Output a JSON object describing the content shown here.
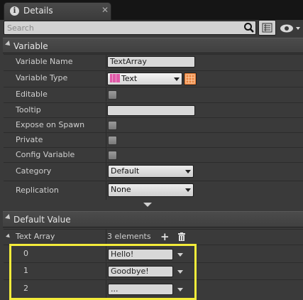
{
  "tab": {
    "title": "Details",
    "close_glyph": "✕",
    "info_glyph": "i"
  },
  "search": {
    "placeholder": "Search",
    "value": ""
  },
  "sections": {
    "variable": {
      "label": "Variable"
    },
    "default_value": {
      "label": "Default Value"
    }
  },
  "properties": {
    "variable_name": {
      "label": "Variable Name",
      "value": "TextArray"
    },
    "variable_type": {
      "label": "Variable Type",
      "value": "Text"
    },
    "editable": {
      "label": "Editable",
      "checked": false
    },
    "tooltip": {
      "label": "Tooltip",
      "value": ""
    },
    "expose_on_spawn": {
      "label": "Expose on Spawn",
      "checked": false
    },
    "private": {
      "label": "Private",
      "checked": false
    },
    "config_variable": {
      "label": "Config Variable",
      "checked": false
    },
    "category": {
      "label": "Category",
      "value": "Default"
    },
    "replication": {
      "label": "Replication",
      "value": "None"
    }
  },
  "text_array": {
    "label": "Text Array",
    "count_text": "3 elements",
    "add_glyph": "+",
    "elements": [
      {
        "index": "0",
        "value": "Hello!"
      },
      {
        "index": "1",
        "value": "Goodbye!"
      },
      {
        "index": "2",
        "value": "..."
      }
    ]
  },
  "colors": {
    "panel_bg": "#3a3a3a",
    "highlight": "#f4ec3a",
    "text_type_pink": "#e15aa8",
    "container_type_orange": "#e8803a"
  }
}
